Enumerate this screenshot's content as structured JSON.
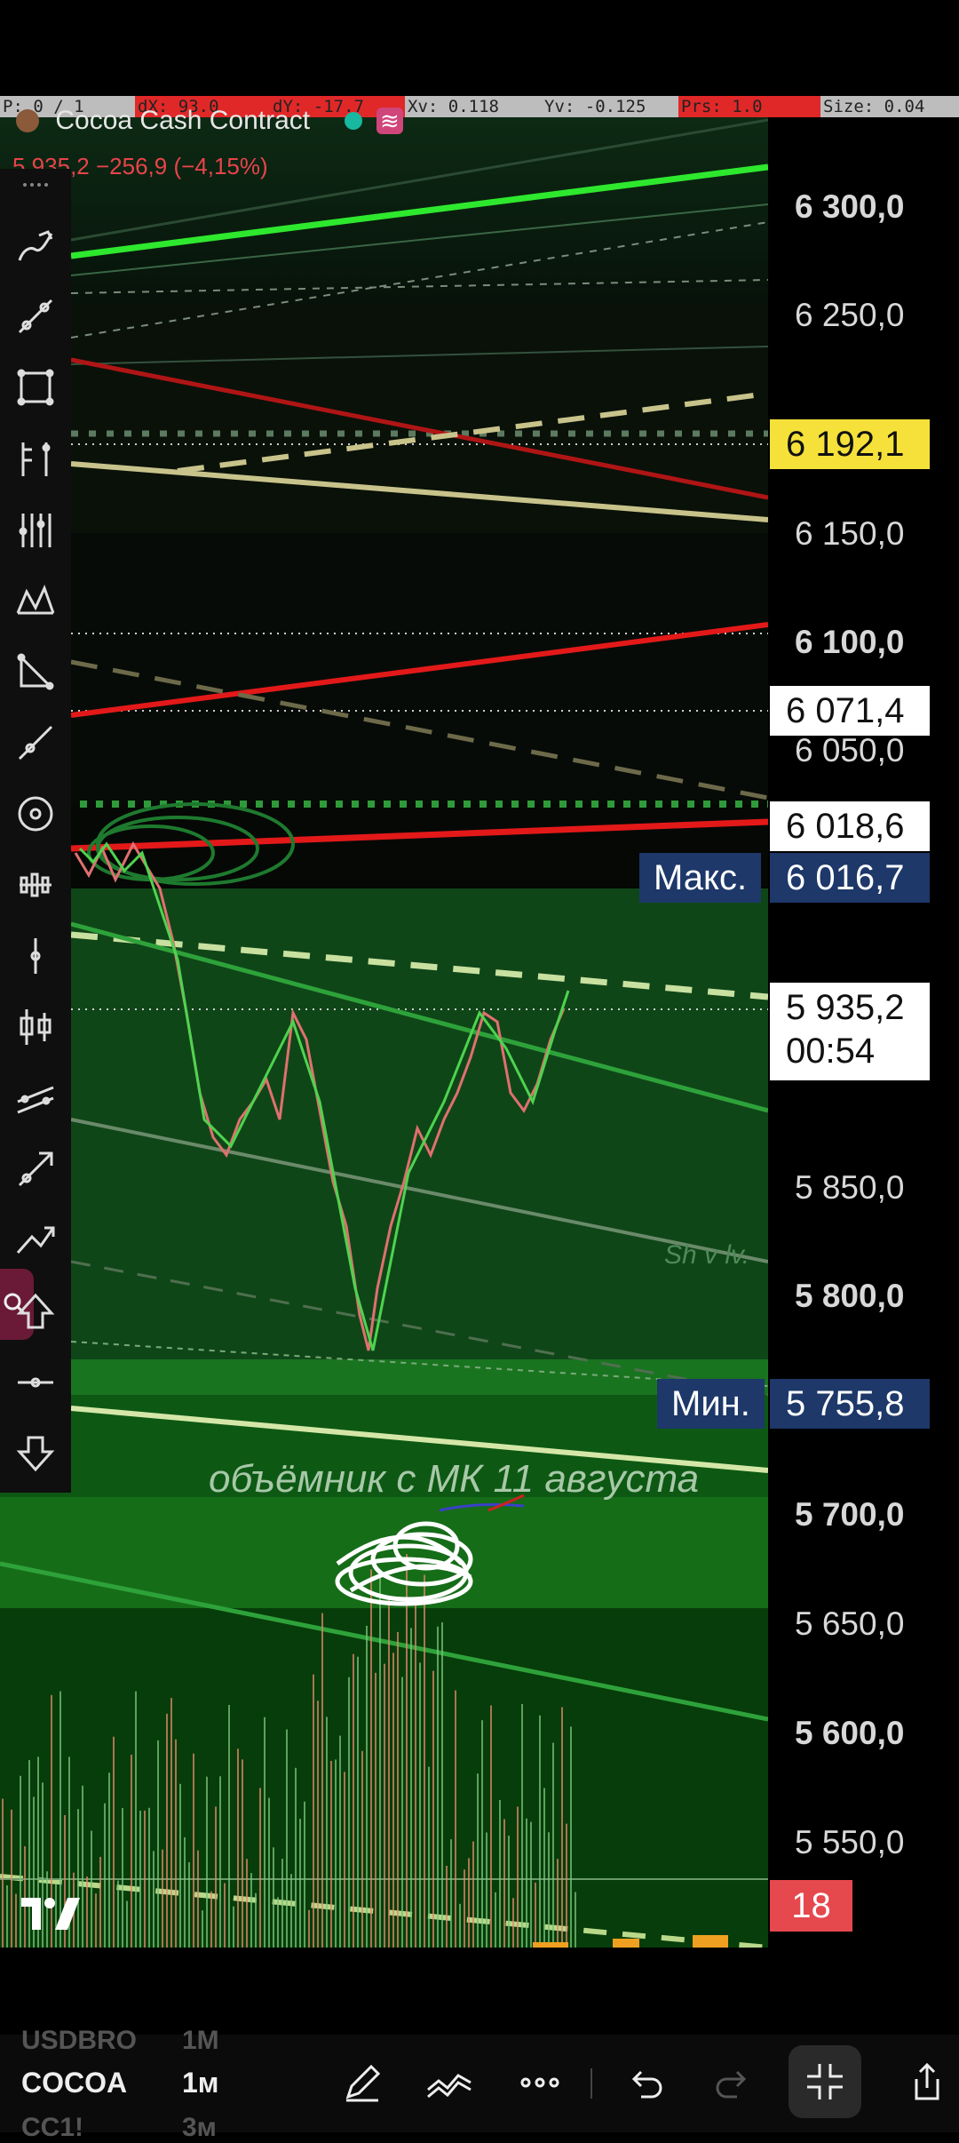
{
  "status_bar": {
    "segments": [
      {
        "text": "P: 0 / 1",
        "bg": "#bdbdbd"
      },
      {
        "text": "dX: 93.0",
        "bg": "#e02828"
      },
      {
        "text": "dY: -17.7",
        "bg": "#e02828"
      },
      {
        "text": "Xv: 0.118",
        "bg": "#bdbdbd"
      },
      {
        "text": "Yv: -0.125",
        "bg": "#bdbdbd"
      },
      {
        "text": "Prs: 1.0",
        "bg": "#e02828"
      },
      {
        "text": "Size: 0.04",
        "bg": "#bdbdbd"
      }
    ]
  },
  "chart": {
    "title": "Cocoa Cash Contract",
    "change": "5 935,2  −256,9 (−4,15%)",
    "annotation": "объёмник с МК 11 августа",
    "pattern_label": "Sh v lv."
  },
  "price_scale": {
    "ticks": [
      {
        "label": "6 300,0",
        "bold": true
      },
      {
        "label": "6 250,0",
        "bold": false
      },
      {
        "label": "6 150,0",
        "bold": false
      },
      {
        "label": "6 100,0",
        "bold": true
      },
      {
        "label": "6 050,0",
        "bold": false
      },
      {
        "label": "5 850,0",
        "bold": false
      },
      {
        "label": "5 800,0",
        "bold": true
      },
      {
        "label": "5 700,0",
        "bold": true
      },
      {
        "label": "5 650,0",
        "bold": false
      },
      {
        "label": "5 600,0",
        "bold": true
      },
      {
        "label": "5 550,0",
        "bold": false
      }
    ],
    "tag_yellow": "6 192,1",
    "tag_white_1": "6 071,4",
    "tag_white_2": "6 018,6",
    "max_label": "Макс.",
    "max_value": "6 016,7",
    "current_price": "5 935,2",
    "countdown": "00:54",
    "min_label": "Мин.",
    "min_value": "5 755,8",
    "volume_badge": "18"
  },
  "colors": {
    "accent_yellow": "#f5e13a",
    "badge_navy": "#1d3869",
    "badge_red": "#e5484d",
    "trend_green": "#2ee82e",
    "trend_red": "#e31919"
  },
  "toolbar": {
    "tools": [
      "freehand-draw-icon",
      "trendline-icon",
      "rectangle-icon",
      "bar-pattern-icon",
      "fib-icon",
      "xabcd-pattern-icon",
      "triangle-icon",
      "ray-icon",
      "circle-icon",
      "candles-icon",
      "vertical-line-icon",
      "candlestick-icon",
      "parallel-channel-icon",
      "arrow-icon",
      "projection-icon",
      "arrow-up-icon",
      "horizontal-line-icon",
      "arrow-down-icon"
    ]
  },
  "bottom_bar": {
    "prev_symbol": "USDBRO",
    "prev_interval": "1M",
    "symbol": "COCOA",
    "interval": "1м",
    "next_symbol": "CC1!",
    "next_interval": "3м"
  }
}
